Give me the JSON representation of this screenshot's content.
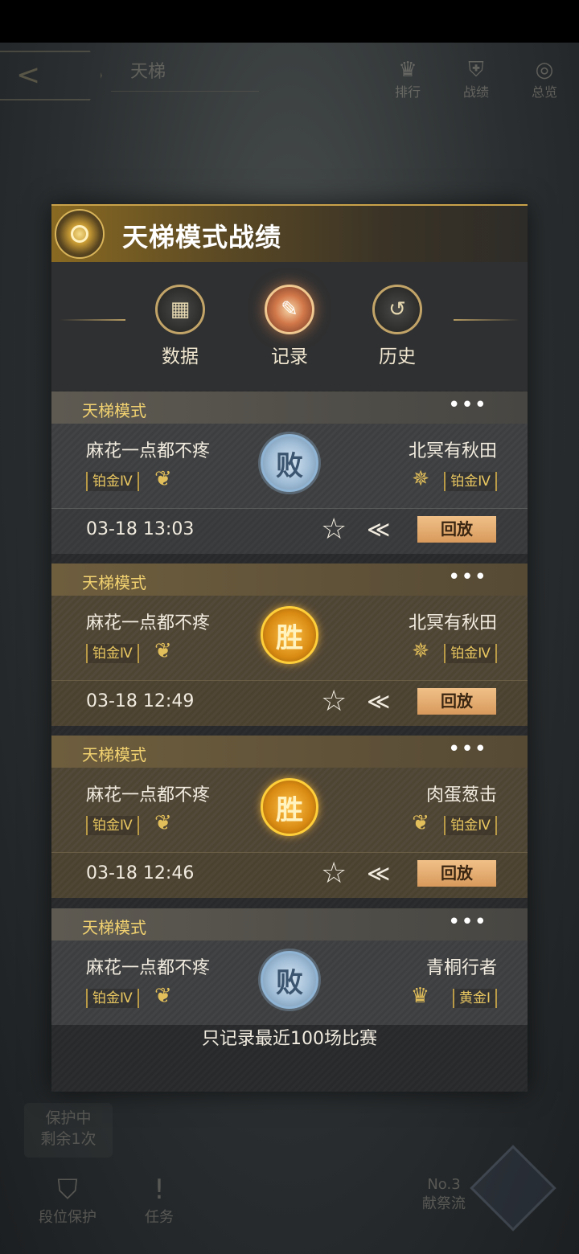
{
  "background": {
    "title": "天梯",
    "top_buttons": [
      {
        "label": "排行",
        "icon": "trophy-icon"
      },
      {
        "label": "战绩",
        "icon": "shield-icon"
      },
      {
        "label": "总览",
        "icon": "overview-icon"
      }
    ],
    "protect_line1": "保护中",
    "protect_line2": "剩余1次",
    "bottom_buttons": [
      {
        "label": "段位保护",
        "icon": "rank-protect-icon"
      },
      {
        "label": "任务",
        "icon": "task-icon"
      }
    ],
    "rank_no": "No.3",
    "rank_name": "献祭流"
  },
  "panel": {
    "title": "天梯模式战绩",
    "tabs": [
      {
        "label": "数据",
        "icon": "chart-icon"
      },
      {
        "label": "记录",
        "icon": "feather-icon"
      },
      {
        "label": "历史",
        "icon": "history-icon"
      }
    ],
    "active_tab": "记录",
    "records": [
      {
        "mode": "天梯模式",
        "more": "•••",
        "left_name": "麻花一点都不疼",
        "left_rank": "铂金Ⅳ",
        "right_name": "北冥有秋田",
        "right_rank": "铂金Ⅳ",
        "result": "败",
        "time": "03-18 13:03",
        "replay": "回放"
      },
      {
        "mode": "天梯模式",
        "more": "•••",
        "left_name": "麻花一点都不疼",
        "left_rank": "铂金Ⅳ",
        "right_name": "北冥有秋田",
        "right_rank": "铂金Ⅳ",
        "result": "胜",
        "time": "03-18 12:49",
        "replay": "回放"
      },
      {
        "mode": "天梯模式",
        "more": "•••",
        "left_name": "麻花一点都不疼",
        "left_rank": "铂金Ⅳ",
        "right_name": "肉蛋葱击",
        "right_rank": "铂金Ⅳ",
        "result": "胜",
        "time": "03-18 12:46",
        "replay": "回放"
      },
      {
        "mode": "天梯模式",
        "more": "•••",
        "left_name": "麻花一点都不疼",
        "left_rank": "铂金Ⅳ",
        "right_name": "青桐行者",
        "right_rank": "黄金Ⅰ",
        "result": "败"
      }
    ],
    "footer_note": "只记录最近100场比赛"
  }
}
